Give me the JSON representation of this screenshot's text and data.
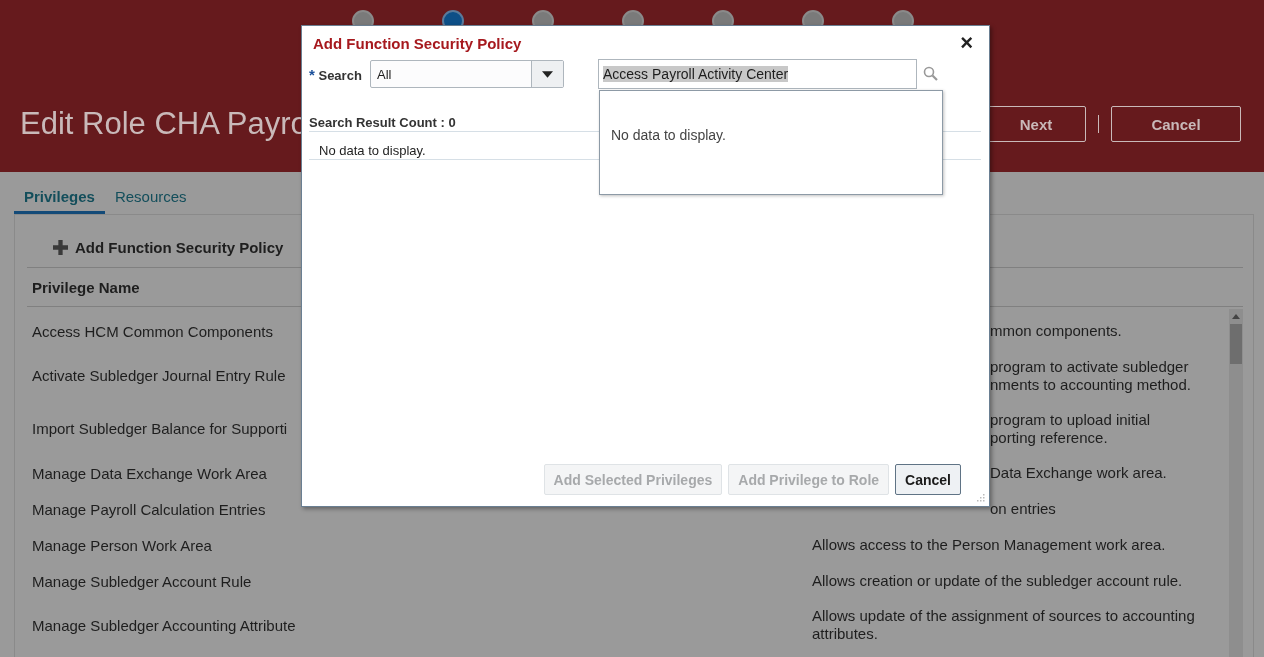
{
  "train": [
    {
      "selected": false
    },
    {
      "selected": true
    },
    {
      "selected": false
    },
    {
      "selected": false
    },
    {
      "selected": false
    },
    {
      "selected": false
    },
    {
      "selected": false
    }
  ],
  "page_title": "Edit Role CHA Payro",
  "header_buttons": [
    {
      "label": "Next",
      "kind": "normal"
    },
    {
      "label": "Cancel",
      "kind": "normal"
    }
  ],
  "tabs": [
    {
      "label": "Privileges",
      "selected": true
    },
    {
      "label": "Resources",
      "selected": false
    }
  ],
  "toolbar": {
    "add_label": "Add Function Security Policy"
  },
  "table": {
    "columns": [
      "Privilege Name"
    ],
    "rows": [
      {
        "name": "Access HCM Common Components",
        "description": [
          "mmon components."
        ],
        "cut": true
      },
      {
        "name": "Activate Subledger Journal Entry Rule",
        "description": [
          "program to activate subledger",
          "nments to accounting method."
        ],
        "cut": true
      },
      {
        "name": "Import Subledger Balance for Supporti",
        "description": [
          "program to upload initial",
          "porting reference."
        ],
        "cut": true
      },
      {
        "name": "Manage Data Exchange Work Area",
        "description": [
          "Data Exchange work area."
        ],
        "cut": true
      },
      {
        "name": "Manage Payroll Calculation Entries",
        "description": [
          "on entries"
        ],
        "cut": true
      },
      {
        "name": "Manage Person Work Area",
        "description": [
          "Allows access to the Person Management work area."
        ],
        "cut": false
      },
      {
        "name": "Manage Subledger Account Rule",
        "description": [
          "Allows creation or update of the subledger account rule."
        ],
        "cut": false
      },
      {
        "name": "Manage Subledger Accounting Attribute",
        "description": [
          "Allows update of the assignment of sources to accounting",
          "attributes."
        ],
        "cut": false
      }
    ]
  },
  "dialog": {
    "title": "Add Function Security Policy",
    "close": "×",
    "required_mark": "*",
    "search_label": "Search",
    "select_value": "All",
    "search_value": "Access Payroll Activity Center",
    "result_count": "Search Result Count : 0",
    "no_data": "No data to display.",
    "popup_no_data": "No data to display.",
    "buttons": [
      {
        "label": "Add Selected Privileges",
        "disabled": true
      },
      {
        "label": "Add Privilege to Role",
        "disabled": true
      },
      {
        "label": "Cancel",
        "disabled": false
      }
    ]
  }
}
